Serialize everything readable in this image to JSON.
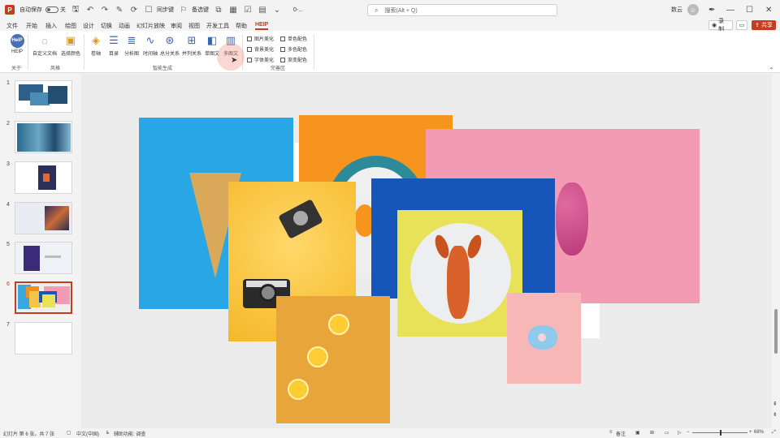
{
  "titlebar": {
    "autosave_label": "自动保存",
    "toggle_state": "关",
    "ribbon_display_label": "同步键",
    "sync_label": "备选键",
    "filename": "0-...",
    "search_placeholder": "搜索(Alt + Q)",
    "user_name": "数云"
  },
  "menu": {
    "tabs": [
      "文件",
      "开始",
      "插入",
      "绘图",
      "设计",
      "切换",
      "动画",
      "幻灯片放映",
      "审阅",
      "视图",
      "开发工具",
      "帮助",
      "HEIP"
    ],
    "active_tab": "HEIP",
    "record_label": "录制",
    "share_label": "共享"
  },
  "ribbon": {
    "buttons": [
      "HEIP",
      "自定义文档",
      "选择颜色",
      "卷轴",
      "目录",
      "分析图",
      "时间轴",
      "总分关系",
      "并列关系",
      "单图文",
      "多图文"
    ],
    "checkboxes_left": [
      "图片美化",
      "背景美化",
      "字体美化"
    ],
    "checkboxes_right": [
      "单色配色",
      "多色配色",
      "渐变配色"
    ],
    "groups": [
      "关于",
      "风格",
      "智能生成",
      "完善区"
    ]
  },
  "slides": {
    "numbers": [
      "1",
      "2",
      "3",
      "4",
      "5",
      "6",
      "7"
    ],
    "active": "6"
  },
  "status": {
    "slide_info": "幻灯片 第 6 张，共 7 张",
    "language": "中文(中国)",
    "accessibility": "辅助功能: 调查",
    "notes": "备注",
    "zoom": "68%"
  },
  "colors": {
    "accent": "#c43e1c",
    "ribbon_icon": "#3a66b0"
  }
}
